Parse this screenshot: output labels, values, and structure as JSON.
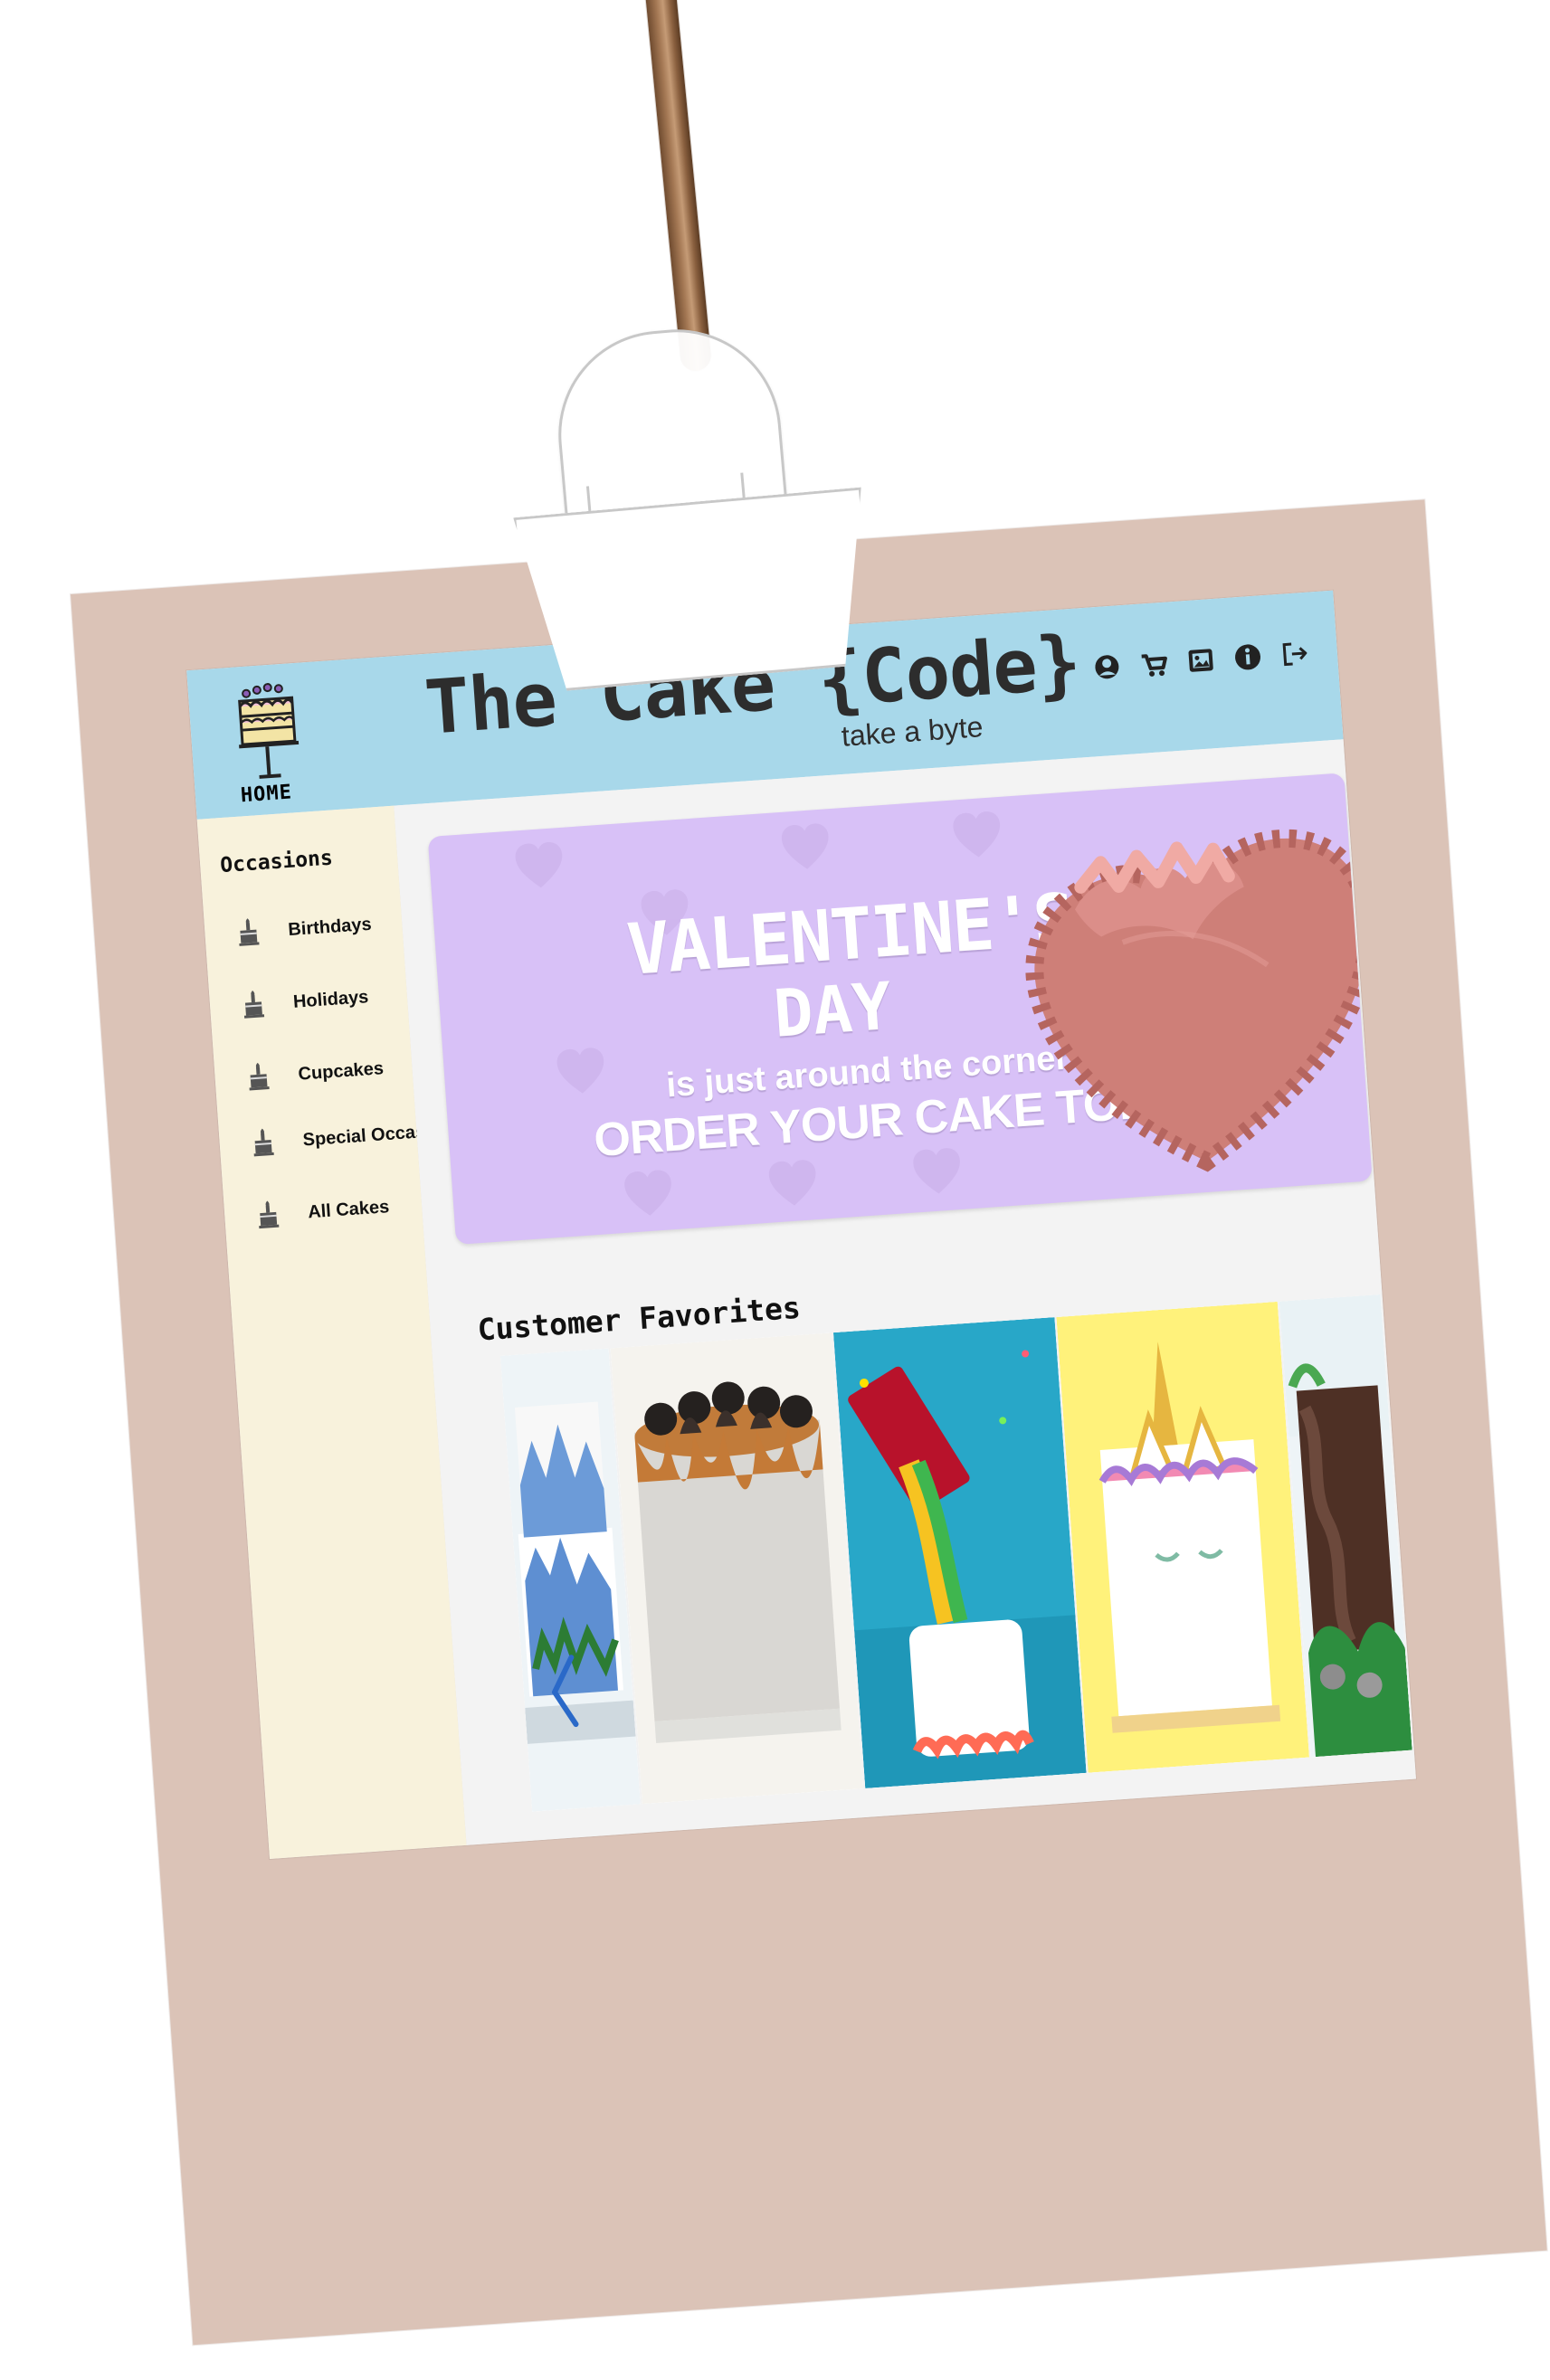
{
  "site": {
    "title": "The Cake {Code}",
    "tagline": "take a byte",
    "home_label": "HOME"
  },
  "header_icons": [
    {
      "name": "account-icon",
      "label": "account"
    },
    {
      "name": "cart-icon",
      "label": "cart"
    },
    {
      "name": "gallery-icon",
      "label": "gallery"
    },
    {
      "name": "info-icon",
      "label": "info"
    },
    {
      "name": "logout-icon",
      "label": "logout"
    }
  ],
  "sidebar": {
    "heading": "Occasions",
    "items": [
      {
        "label": "Birthdays",
        "icon": "cake-icon"
      },
      {
        "label": "Holidays",
        "icon": "cake-icon"
      },
      {
        "label": "Cupcakes",
        "icon": "cake-icon"
      },
      {
        "label": "Special Occasions",
        "icon": "cake-icon"
      },
      {
        "label": "All Cakes",
        "icon": "cake-icon"
      }
    ]
  },
  "promo": {
    "line1": "VALENTINE'S",
    "line2": "DAY",
    "line3": "is just around the corner",
    "line4": "ORDER YOUR CAKE TODAY!",
    "background": "#d8c1f7",
    "text_color": "#ffffff"
  },
  "favorites": {
    "title": "Customer Favorites",
    "items": [
      {
        "name": "mountain-cake",
        "image": "mountain cake"
      },
      {
        "name": "oreo-caramel-cake",
        "image": "oreo caramel cake"
      },
      {
        "name": "skittles-cake",
        "image": "skittles cake"
      },
      {
        "name": "unicorn-cake",
        "image": "unicorn cake"
      },
      {
        "name": "fairy-house-cake",
        "image": "fairy house cake"
      }
    ]
  },
  "colors": {
    "header": "#a8d8ea",
    "sidebar": "#f8f2dc",
    "frame": "#dbc3b7",
    "main": "#f3f3f3",
    "promo": "#d8c1f7"
  }
}
